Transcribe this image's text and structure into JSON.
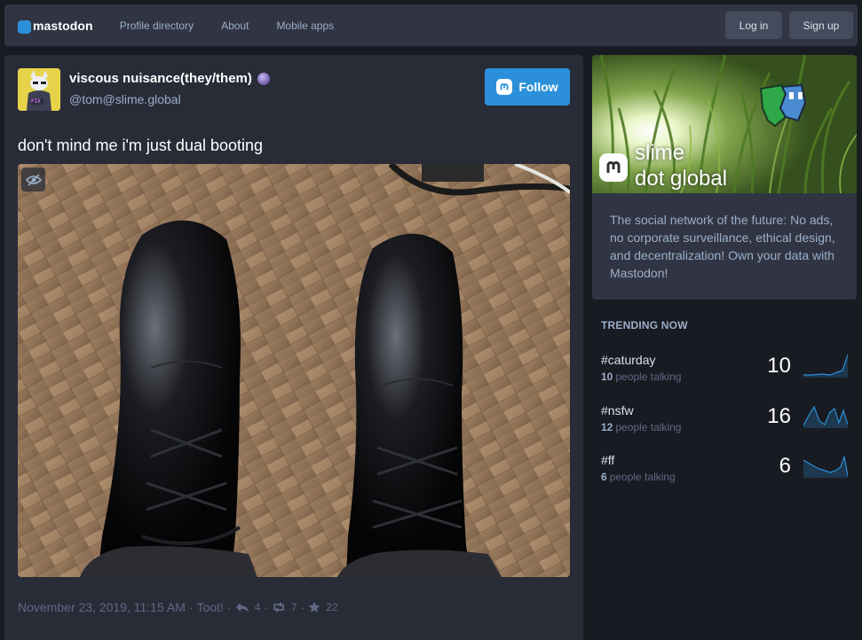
{
  "nav": {
    "brand": "mastodon",
    "links": [
      "Profile directory",
      "About",
      "Mobile apps"
    ],
    "login": "Log in",
    "signup": "Sign up"
  },
  "status": {
    "display_name": "viscous nuisance(they/them)",
    "acct": "@tom@slime.global",
    "follow_label": "Follow",
    "text": "don't mind me i'm just dual booting",
    "avatar_text": "FIX",
    "meta": {
      "timestamp": "November 23, 2019, 11:15 AM",
      "application": "Toot!",
      "replies": "4",
      "boosts": "7",
      "favourites": "22"
    }
  },
  "sidebar": {
    "hero_title_line1": "slime",
    "hero_title_line2": "dot global",
    "about": "The social network of the future: No ads, no corporate surveillance, ethical design, and decentralization! Own your data with Mastodon!",
    "trending_title": "Trending now",
    "trends": [
      {
        "tag": "#caturday",
        "people": "10",
        "people_suffix": "people talking",
        "count": "10"
      },
      {
        "tag": "#nsfw",
        "people": "12",
        "people_suffix": "people talking",
        "count": "16"
      },
      {
        "tag": "#ff",
        "people": "6",
        "people_suffix": "people talking",
        "count": "6"
      }
    ]
  },
  "colors": {
    "accent": "#2b90d9",
    "background": "#191b22",
    "panel": "#282c37",
    "nav": "#313543",
    "muted": "#606984",
    "secondary": "#9baec8"
  }
}
